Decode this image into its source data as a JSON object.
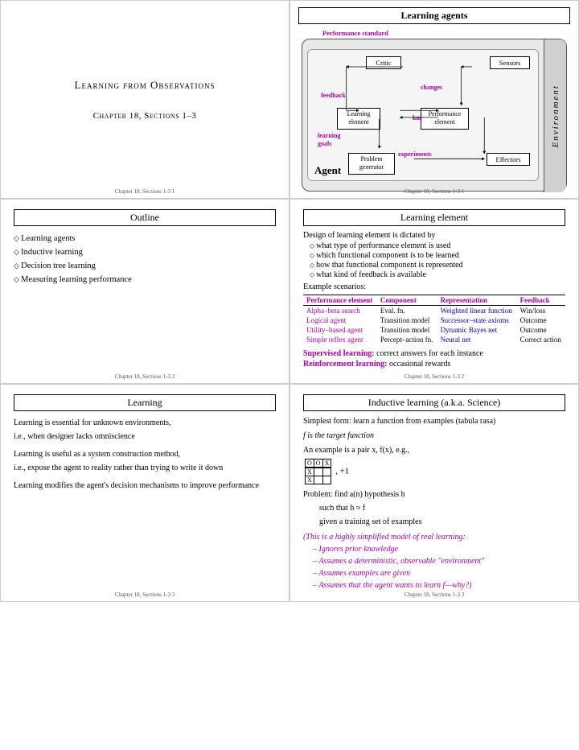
{
  "slides": {
    "slide1": {
      "title": "Learning from Observations",
      "subtitle": "Chapter 18, Sections 1–3",
      "footer": "Chapter 18, Sections 1-3   1"
    },
    "slide2": {
      "title": "Learning agents",
      "footer": "Chapter 18, Sections 1-3   1",
      "labels": {
        "performance_standard": "Performance standard",
        "critic": "Critic",
        "sensors": "Sensors",
        "feedback": "feedback",
        "changes": "changes",
        "knowledge": "knowledge",
        "learning_element": "Learning\nelement",
        "performance_element": "Performance\nelement",
        "learning_goals": "learning\ngoals",
        "experiments": "experiments",
        "problem_generator": "Problem\ngenerator",
        "agent": "Agent",
        "effectors": "Effectors",
        "environment": "Environment"
      }
    },
    "slide3": {
      "title": "Outline",
      "footer": "Chapter 18, Sections 1-3   2",
      "items": [
        "Learning agents",
        "Inductive learning",
        "Decision tree learning",
        "Measuring learning performance"
      ]
    },
    "slide4": {
      "title": "Learning element",
      "footer": "Chapter 18, Sections 1-3   2",
      "description": "Design of learning element is dictated by",
      "bullets": [
        "what type of performance element is used",
        "which functional component is to be learned",
        "how that functional component is represented",
        "what kind of feedback is available"
      ],
      "example_label": "Example scenarios:",
      "table_headers": [
        "Performance element",
        "Component",
        "Representation",
        "Feedback"
      ],
      "table_rows": [
        [
          "Alpha–beta search",
          "Eval. fn.",
          "Weighted linear function",
          "Win/loss"
        ],
        [
          "Logical agent",
          "Transition model",
          "Successor–state axioms",
          "Outcome"
        ],
        [
          "Utility–based agent",
          "Transition model",
          "Dynamic Bayes net",
          "Outcome"
        ],
        [
          "Simple reflex agent",
          "Percept–action fn.",
          "Neural net",
          "Correct action"
        ]
      ],
      "supervised_text": "Supervised learning:  correct answers for each instance",
      "reinforcement_text": "Reinforcement learning:  occasional rewards"
    },
    "slide5": {
      "title": "Learning",
      "footer": "Chapter 18, Sections 1-3   3",
      "paragraphs": [
        "Learning is essential for unknown environments,",
        "i.e., when designer lacks omniscience",
        "",
        "Learning is useful as a system construction method,",
        "i.e., expose the agent to reality rather than trying to write it down",
        "",
        "Learning modifies the agent's decision mechanisms to improve performance"
      ]
    },
    "slide6": {
      "title": "Inductive learning (a.k.a. Science)",
      "footer": "Chapter 18, Sections 1-3   3",
      "simplest": "Simplest form:  learn a function from examples (tabula rasa)",
      "f_label": "f  is the target function",
      "example_text": "An example is a pair x, f(x), e.g.,",
      "table_data": {
        "headers": [
          "O",
          "O",
          "X"
        ],
        "row1": [
          "X",
          ""
        ],
        "row2": [
          "X",
          ""
        ],
        "plus1": "+1"
      },
      "problem": "Problem:  find a(n) hypothesis h",
      "hypothesis_lines": [
        "such that h ≈ f",
        "given a training set of examples"
      ],
      "simp_model_lines": [
        "(This is a highly simplified model of real learning:",
        "– Ignores prior knowledge",
        "– Assumes a deterministic, observable \"environment\"",
        "– Assumes examples are given",
        "– Assumes that the agent wants to learn f—why?)"
      ]
    }
  }
}
